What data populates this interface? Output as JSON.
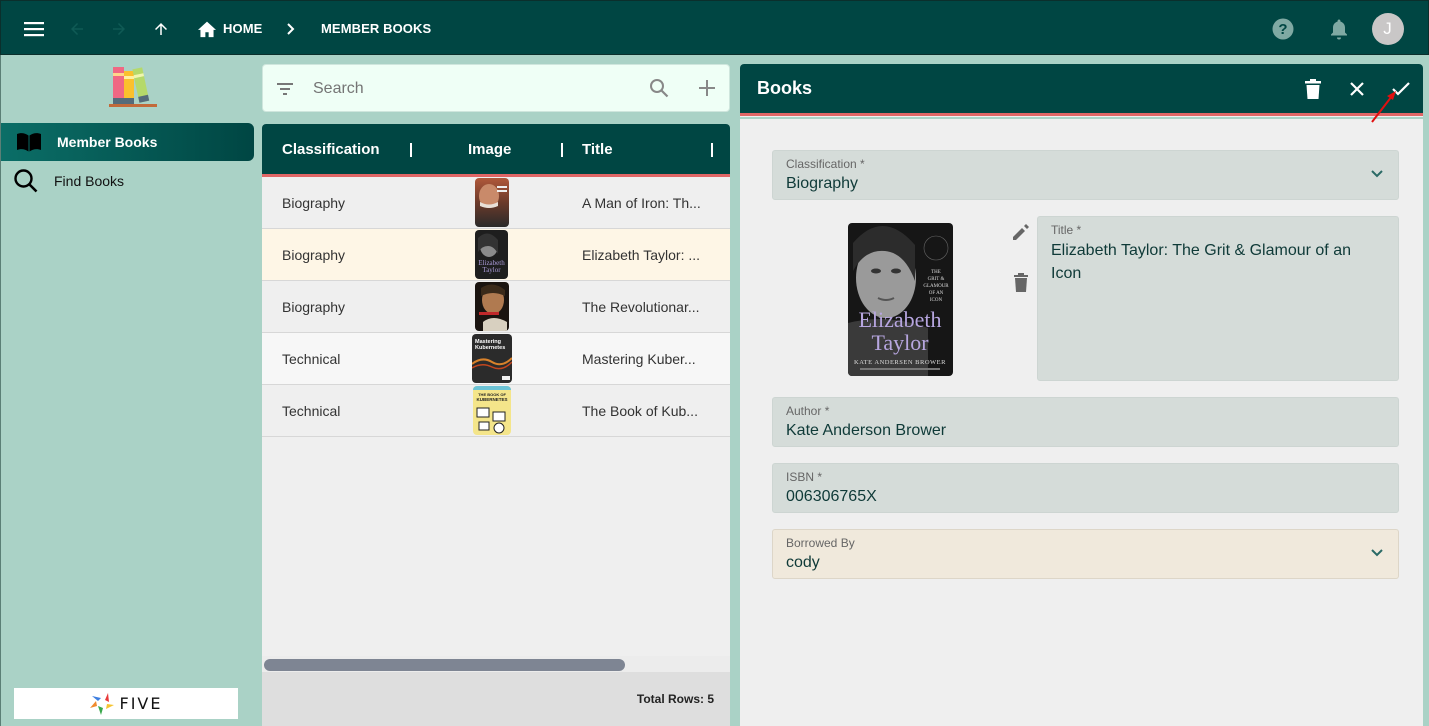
{
  "topbar": {
    "breadcrumb": [
      {
        "label": "HOME",
        "icon": "home-icon"
      },
      {
        "label": "MEMBER BOOKS"
      }
    ],
    "avatar_initial": "J",
    "icons": [
      "menu-icon",
      "back-arrow-icon",
      "forward-arrow-icon",
      "up-arrow-icon",
      "help-icon",
      "bell-icon"
    ]
  },
  "sidebar": {
    "items": [
      {
        "label": "Member Books",
        "icon": "open-book-icon",
        "active": true
      },
      {
        "label": "Find Books",
        "icon": "search-icon",
        "active": false
      }
    ],
    "footer_logo": "FIVE"
  },
  "list": {
    "search_placeholder": "Search",
    "columns": [
      "Classification",
      "Image",
      "Title"
    ],
    "rows": [
      {
        "classification": "Biography",
        "title": "A Man of Iron: Th...",
        "selected": false
      },
      {
        "classification": "Biography",
        "title": "Elizabeth Taylor: ...",
        "selected": true
      },
      {
        "classification": "Biography",
        "title": "The Revolutionar...",
        "selected": false
      },
      {
        "classification": "Technical",
        "title": "Mastering Kuber...",
        "selected": false
      },
      {
        "classification": "Technical",
        "title": "The Book of Kub...",
        "selected": false
      }
    ],
    "total_rows_label": "Total Rows: 5"
  },
  "form": {
    "title": "Books",
    "fields": {
      "classification": {
        "label": "Classification *",
        "value": "Biography"
      },
      "title": {
        "label": "Title *",
        "value": "Elizabeth Taylor: The Grit & Glamour of an Icon"
      },
      "author": {
        "label": "Author *",
        "value": "Kate Anderson Brower"
      },
      "isbn": {
        "label": "ISBN *",
        "value": "006306765X"
      },
      "borrowed_by": {
        "label": "Borrowed By",
        "value": "cody"
      }
    },
    "cover": {
      "title_line1": "Elizabeth",
      "title_line2": "Taylor",
      "author": "KATE ANDERSEN BROWER",
      "subtitle": "THE GRIT & GLAMOUR OF AN ICON"
    }
  },
  "colors": {
    "primary": "#004643",
    "accent": "#e06666",
    "background": "#aad2c6",
    "selected_row": "#fef6e6"
  }
}
